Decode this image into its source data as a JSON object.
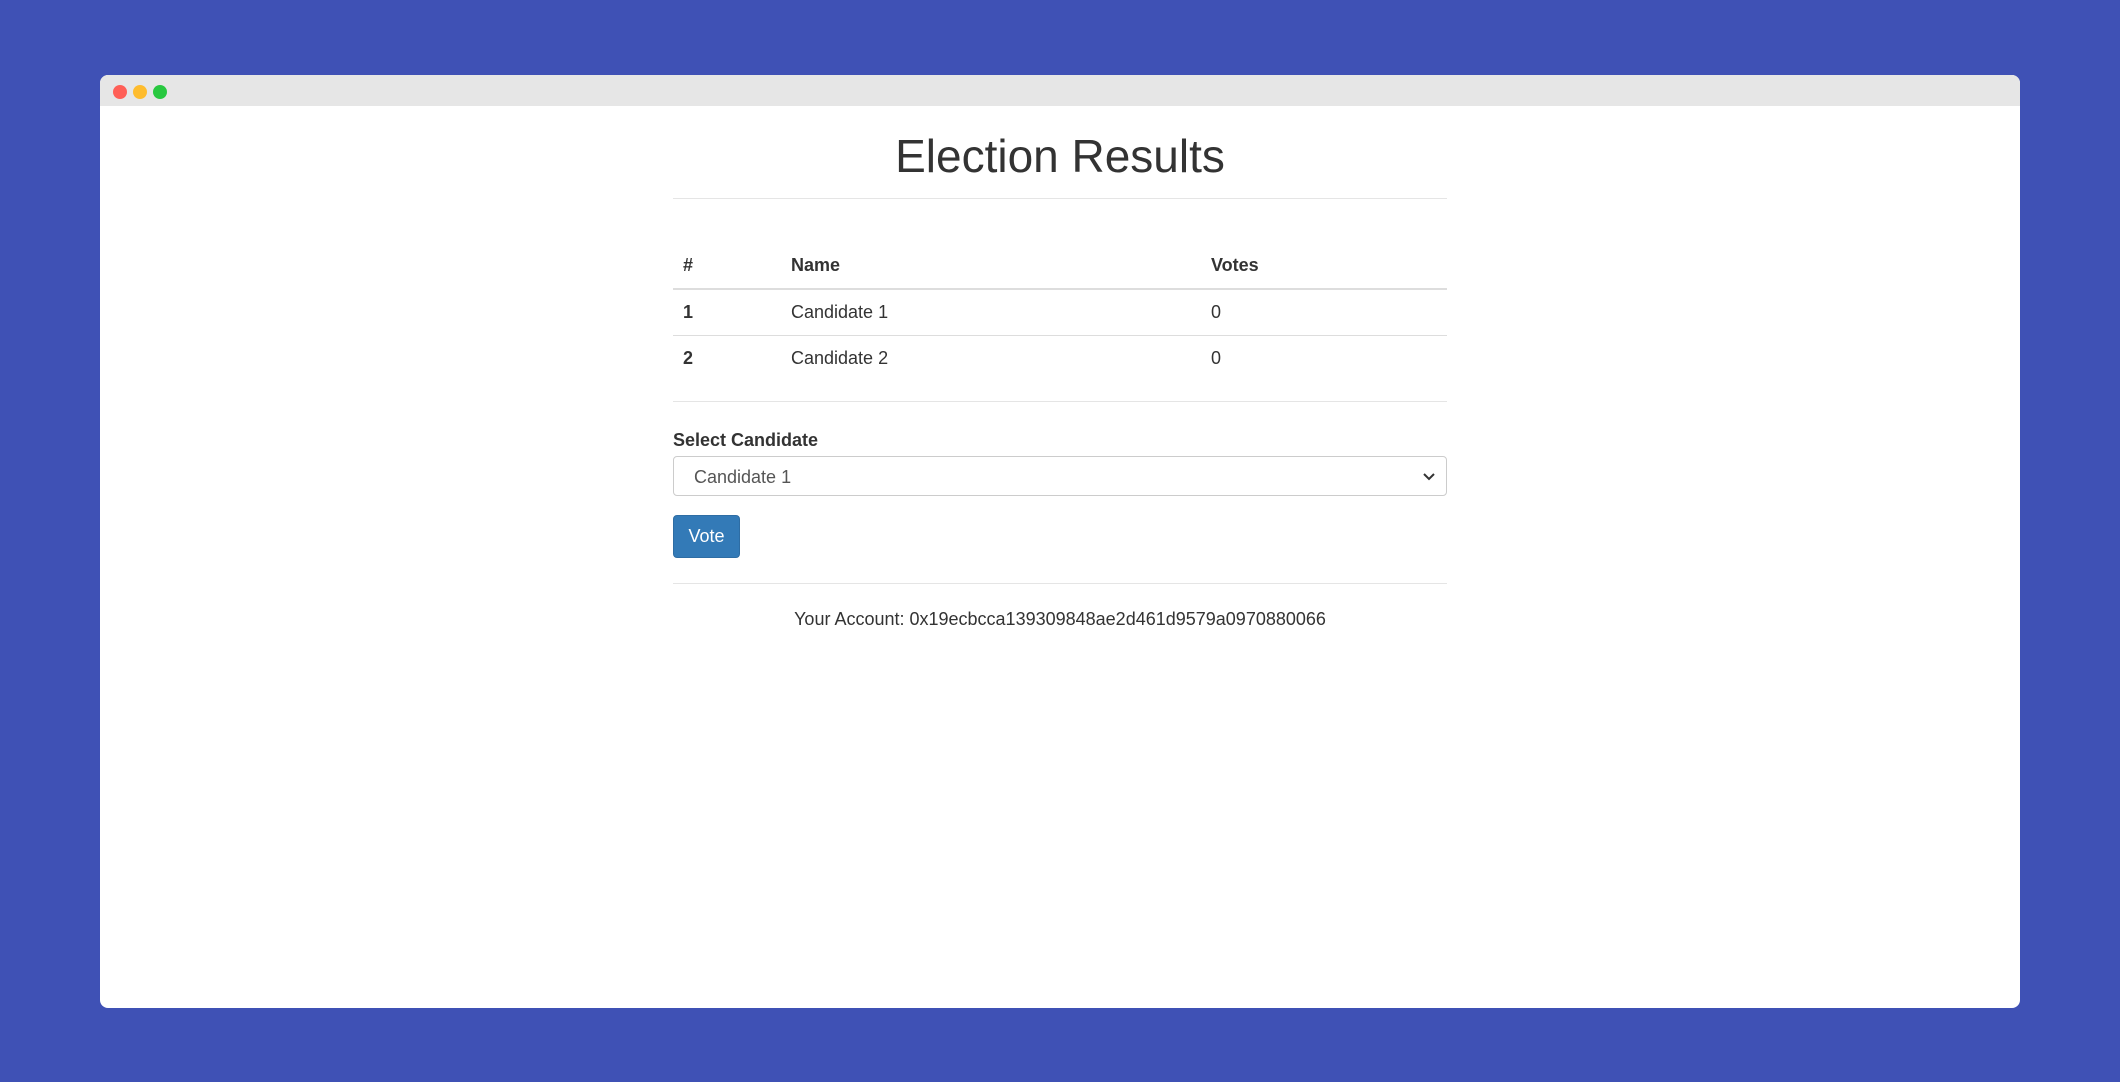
{
  "window": {
    "controls": [
      "close",
      "minimize",
      "maximize"
    ]
  },
  "page": {
    "title": "Election Results"
  },
  "table": {
    "headers": [
      "#",
      "Name",
      "Votes"
    ],
    "rows": [
      {
        "num": "1",
        "name": "Candidate 1",
        "votes": "0"
      },
      {
        "num": "2",
        "name": "Candidate 2",
        "votes": "0"
      }
    ]
  },
  "form": {
    "label": "Select Candidate",
    "selected": "Candidate 1",
    "button_label": "Vote"
  },
  "account": {
    "text": "Your Account: 0x19ecbcca139309848ae2d461d9579a0970880066"
  },
  "colors": {
    "background": "#3f51b5",
    "button": "#337ab7"
  }
}
